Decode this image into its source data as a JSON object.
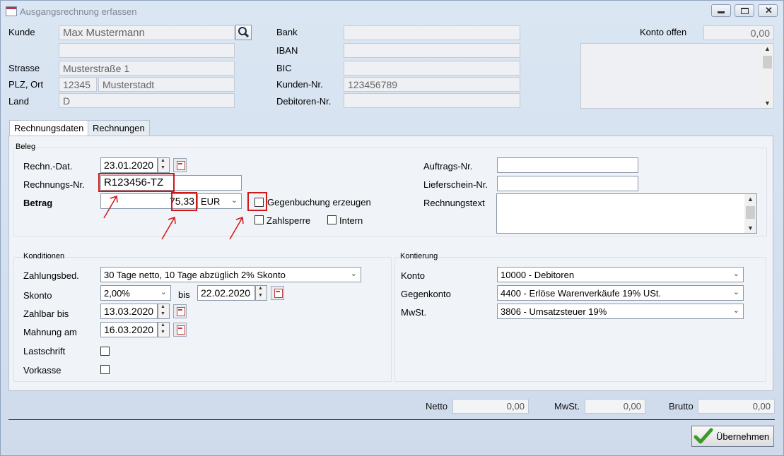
{
  "window": {
    "title": "Ausgangsrechnung erfassen"
  },
  "customer": {
    "kunde_label": "Kunde",
    "kunde_value": "Max Mustermann",
    "kunde_line2": "",
    "strasse_label": "Strasse",
    "strasse_value": "Musterstraße 1",
    "plz_ort_label": "PLZ, Ort",
    "plz_value": "12345",
    "ort_value": "Musterstadt",
    "land_label": "Land",
    "land_value": "D"
  },
  "bank": {
    "bank_label": "Bank",
    "bank_value": "",
    "iban_label": "IBAN",
    "iban_value": "",
    "bic_label": "BIC",
    "bic_value": "",
    "kunden_nr_label": "Kunden-Nr.",
    "kunden_nr_value": "123456789",
    "debitoren_label": "Debitoren-Nr.",
    "debitoren_value": ""
  },
  "konto_offen": {
    "label": "Konto offen",
    "value": "0,00"
  },
  "tabs": [
    {
      "label": "Rechnungsdaten",
      "active": true
    },
    {
      "label": "Rechnungen",
      "active": false
    }
  ],
  "beleg": {
    "group_title": "Beleg",
    "rechn_dat_label": "Rechn.-Dat.",
    "rechn_dat_value": "23.01.2020",
    "rechnungs_nr_label": "Rechnungs-Nr.",
    "rechnungs_nr_value": "R123456-TZ",
    "betrag_label": "Betrag",
    "betrag_value": "75,33",
    "currency": "EUR",
    "gegenbuchung_label": "Gegenbuchung erzeugen",
    "zahlsperre_label": "Zahlsperre",
    "intern_label": "Intern",
    "auftrags_nr_label": "Auftrags-Nr.",
    "auftrags_nr_value": "",
    "lieferschein_label": "Lieferschein-Nr.",
    "lieferschein_value": "",
    "rechnungstext_label": "Rechnungstext"
  },
  "konditionen": {
    "group_title": "Konditionen",
    "zahlungsbed_label": "Zahlungsbed.",
    "zahlungsbed_value": "30 Tage netto, 10 Tage abzüglich 2% Skonto",
    "skonto_label": "Skonto",
    "skonto_value": "2,00%",
    "bis_label": "bis",
    "skonto_bis_value": "22.02.2020",
    "zahlbar_label": "Zahlbar bis",
    "zahlbar_value": "13.03.2020",
    "mahnung_label": "Mahnung am",
    "mahnung_value": "16.03.2020",
    "lastschrift_label": "Lastschrift",
    "vorkasse_label": "Vorkasse"
  },
  "kontierung": {
    "group_title": "Kontierung",
    "konto_label": "Konto",
    "konto_value": "10000  - Debitoren",
    "gegenkonto_label": "Gegenkonto",
    "gegenkonto_value": "4400 - Erlöse Warenverkäufe 19% USt.",
    "mwst_label": "MwSt.",
    "mwst_value": "3806 - Umsatzsteuer 19%"
  },
  "totals": {
    "netto_label": "Netto",
    "netto_value": "0,00",
    "mwst_label": "MwSt.",
    "mwst_value": "0,00",
    "brutto_label": "Brutto",
    "brutto_value": "0,00"
  },
  "actions": {
    "submit_label": "Übernehmen"
  },
  "colors": {
    "annotation_red": "#d01818",
    "window_bg": "#d5e0ee",
    "check_green": "#3a9a2a"
  }
}
